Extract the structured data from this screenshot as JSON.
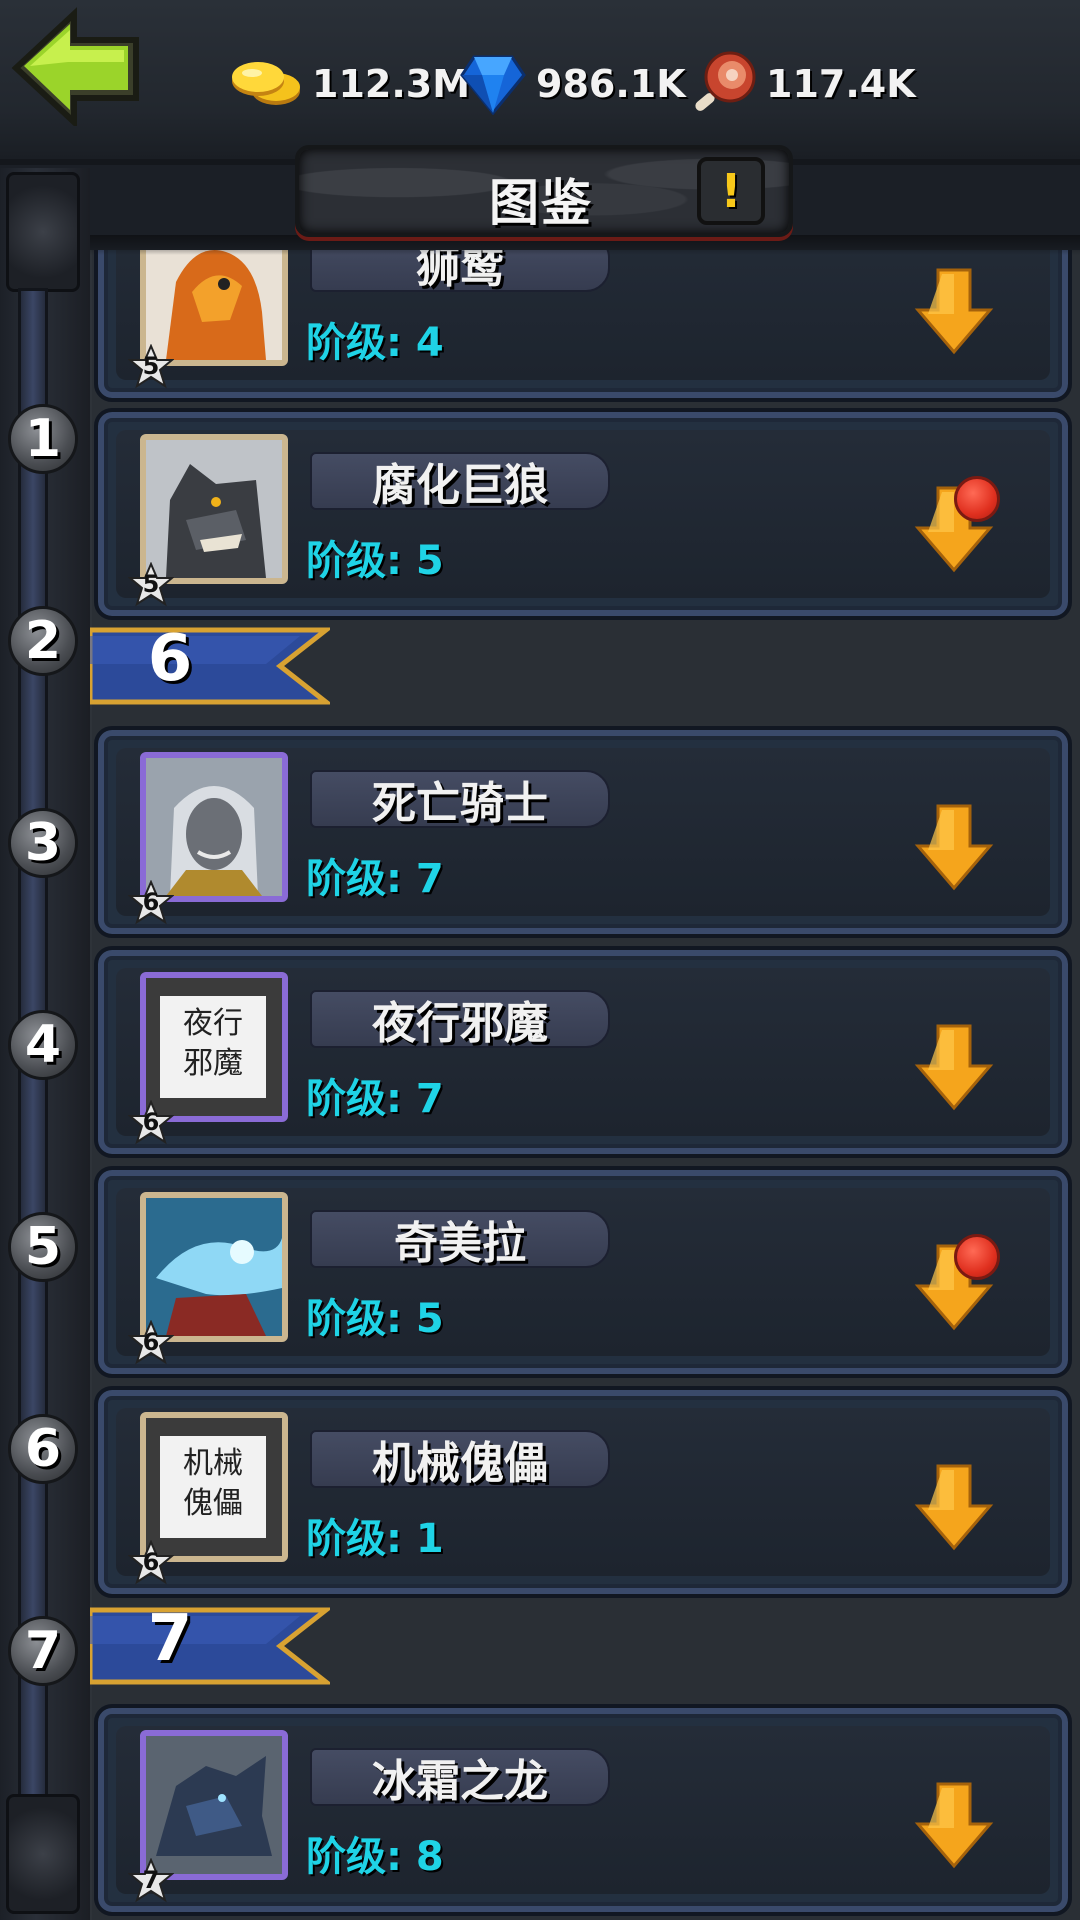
{
  "header": {
    "title": "图鉴",
    "resources": [
      {
        "name": "gold",
        "icon": "gold-coins-icon",
        "value": "112.3M"
      },
      {
        "name": "gems",
        "icon": "blue-gem-icon",
        "value": "986.1K"
      },
      {
        "name": "meat",
        "icon": "meat-icon",
        "value": "117.4K"
      }
    ],
    "info_label": "!"
  },
  "rail_numbers": [
    "1",
    "2",
    "3",
    "4",
    "5",
    "6",
    "7"
  ],
  "ranks": [
    {
      "label": "6"
    },
    {
      "label": "7"
    }
  ],
  "cards": [
    {
      "name": "狮鹫",
      "level": "阶级: 4",
      "stars": "5",
      "frame": "gold",
      "alert": false
    },
    {
      "name": "腐化巨狼",
      "level": "阶级: 5",
      "stars": "5",
      "frame": "gold",
      "alert": true
    },
    {
      "name": "死亡骑士",
      "level": "阶级: 7",
      "stars": "6",
      "frame": "purple",
      "alert": false
    },
    {
      "name": "夜行邪魔",
      "level": "阶级: 7",
      "stars": "6",
      "frame": "purple",
      "alert": false,
      "placeholder": "夜行 邪魔"
    },
    {
      "name": "奇美拉",
      "level": "阶级: 5",
      "stars": "6",
      "frame": "gold",
      "alert": true
    },
    {
      "name": "机械傀儡",
      "level": "阶级: 1",
      "stars": "6",
      "frame": "gold",
      "alert": false,
      "placeholder": "机械 傀儡"
    },
    {
      "name": "冰霜之龙",
      "level": "阶级: 8",
      "stars": "7",
      "frame": "purple",
      "alert": false
    }
  ],
  "colors": {
    "level_text": "#1fd3e6",
    "arrow": "#f5a51c",
    "alert_dot": "#e0301f",
    "ribbon": "#2c4a9a"
  }
}
